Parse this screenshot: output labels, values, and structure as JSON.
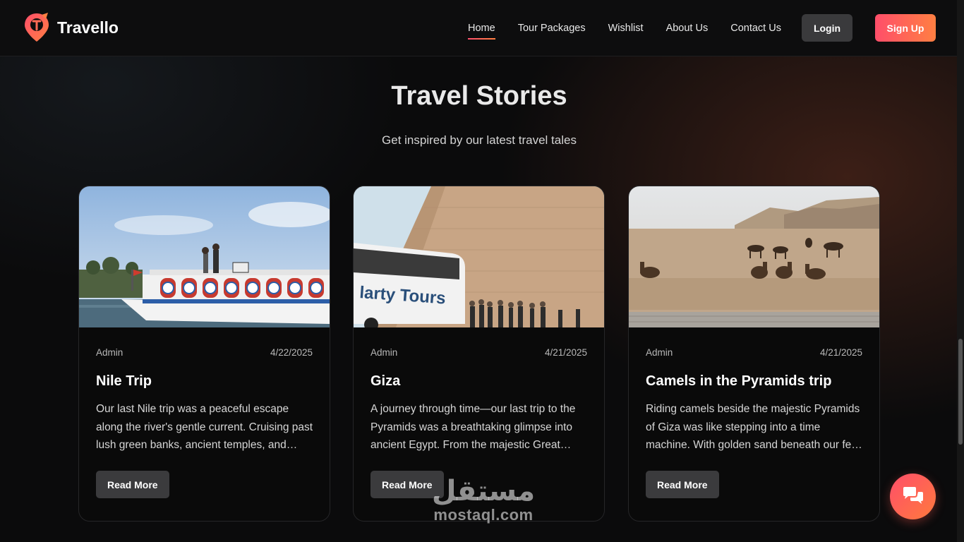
{
  "brand": {
    "name": "Travello",
    "accent_start": "#ff4e6a",
    "accent_end": "#ff7f42"
  },
  "nav": {
    "links": [
      {
        "label": "Home",
        "active": true
      },
      {
        "label": "Tour Packages",
        "active": false
      },
      {
        "label": "Wishlist",
        "active": false
      },
      {
        "label": "About Us",
        "active": false
      },
      {
        "label": "Contact Us",
        "active": false
      }
    ],
    "login_label": "Login",
    "signup_label": "Sign Up"
  },
  "section": {
    "title": "Travel Stories",
    "subtitle": "Get inspired by our latest travel tales"
  },
  "cards": [
    {
      "author": "Admin",
      "date": "4/22/2025",
      "title": "Nile Trip",
      "excerpt": "Our last Nile trip was a peaceful escape along the river's gentle current. Cruising past lush green banks, ancient temples, and charming villages.",
      "button": "Read More",
      "image": "nile-boat-photo"
    },
    {
      "author": "Admin",
      "date": "4/21/2025",
      "title": "Giza",
      "excerpt": "A journey through time—our last trip to the Pyramids was a breathtaking glimpse into ancient Egypt. From the majestic Great Pyramid to the Sphinx.",
      "button": "Read More",
      "image": "great-pyramid-photo"
    },
    {
      "author": "Admin",
      "date": "4/21/2025",
      "title": "Camels in the Pyramids trip",
      "excerpt": "Riding camels beside the majestic Pyramids of Giza was like stepping into a time machine. With golden sand beneath our feet and history all around.",
      "button": "Read More",
      "image": "camels-desert-photo"
    }
  ],
  "chat": {
    "icon": "chat-bubbles-icon"
  },
  "watermark": {
    "arabic": "مستقل",
    "latin": "mostaql.com"
  }
}
